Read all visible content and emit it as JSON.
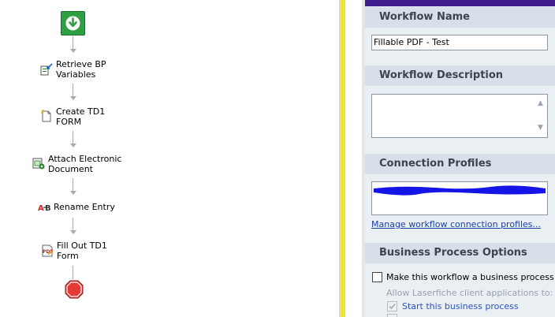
{
  "workflow": {
    "activities": [
      {
        "label": [
          "Retrieve BP",
          "Variables"
        ],
        "icon": "retrieve-variables-icon"
      },
      {
        "label": [
          "Create TD1",
          "FORM"
        ],
        "icon": "create-document-icon"
      },
      {
        "label": [
          "Attach Electronic",
          "Document"
        ],
        "icon": "attach-document-icon"
      },
      {
        "label": [
          "Rename Entry"
        ],
        "icon": "rename-entry-icon"
      },
      {
        "label": [
          "Fill Out TD1",
          "Form"
        ],
        "icon": "pdf-form-icon"
      }
    ],
    "start_icon": "start-arrow-icon",
    "end_icon": "stop-octagon-icon"
  },
  "properties": {
    "workflow_name": {
      "header": "Workflow Name",
      "value": "Fillable PDF - Test"
    },
    "workflow_description": {
      "header": "Workflow Description",
      "value": ""
    },
    "connection_profiles": {
      "header": "Connection Profiles",
      "manage_link": "Manage workflow connection profiles..."
    },
    "business_process": {
      "header": "Business Process Options",
      "make_bp_label": "Make this workflow a business process",
      "allow_label": "Allow Laserfiche client applications to:",
      "start_bp_label": "Start this business process"
    }
  },
  "colors": {
    "pane_background": "#eaeff4",
    "section_header": "#d7dfe8",
    "top_bar": "#3f1d8c",
    "splitter_accent": "#f2e437",
    "link": "#1a3ea8",
    "redaction": "#1414e6"
  }
}
